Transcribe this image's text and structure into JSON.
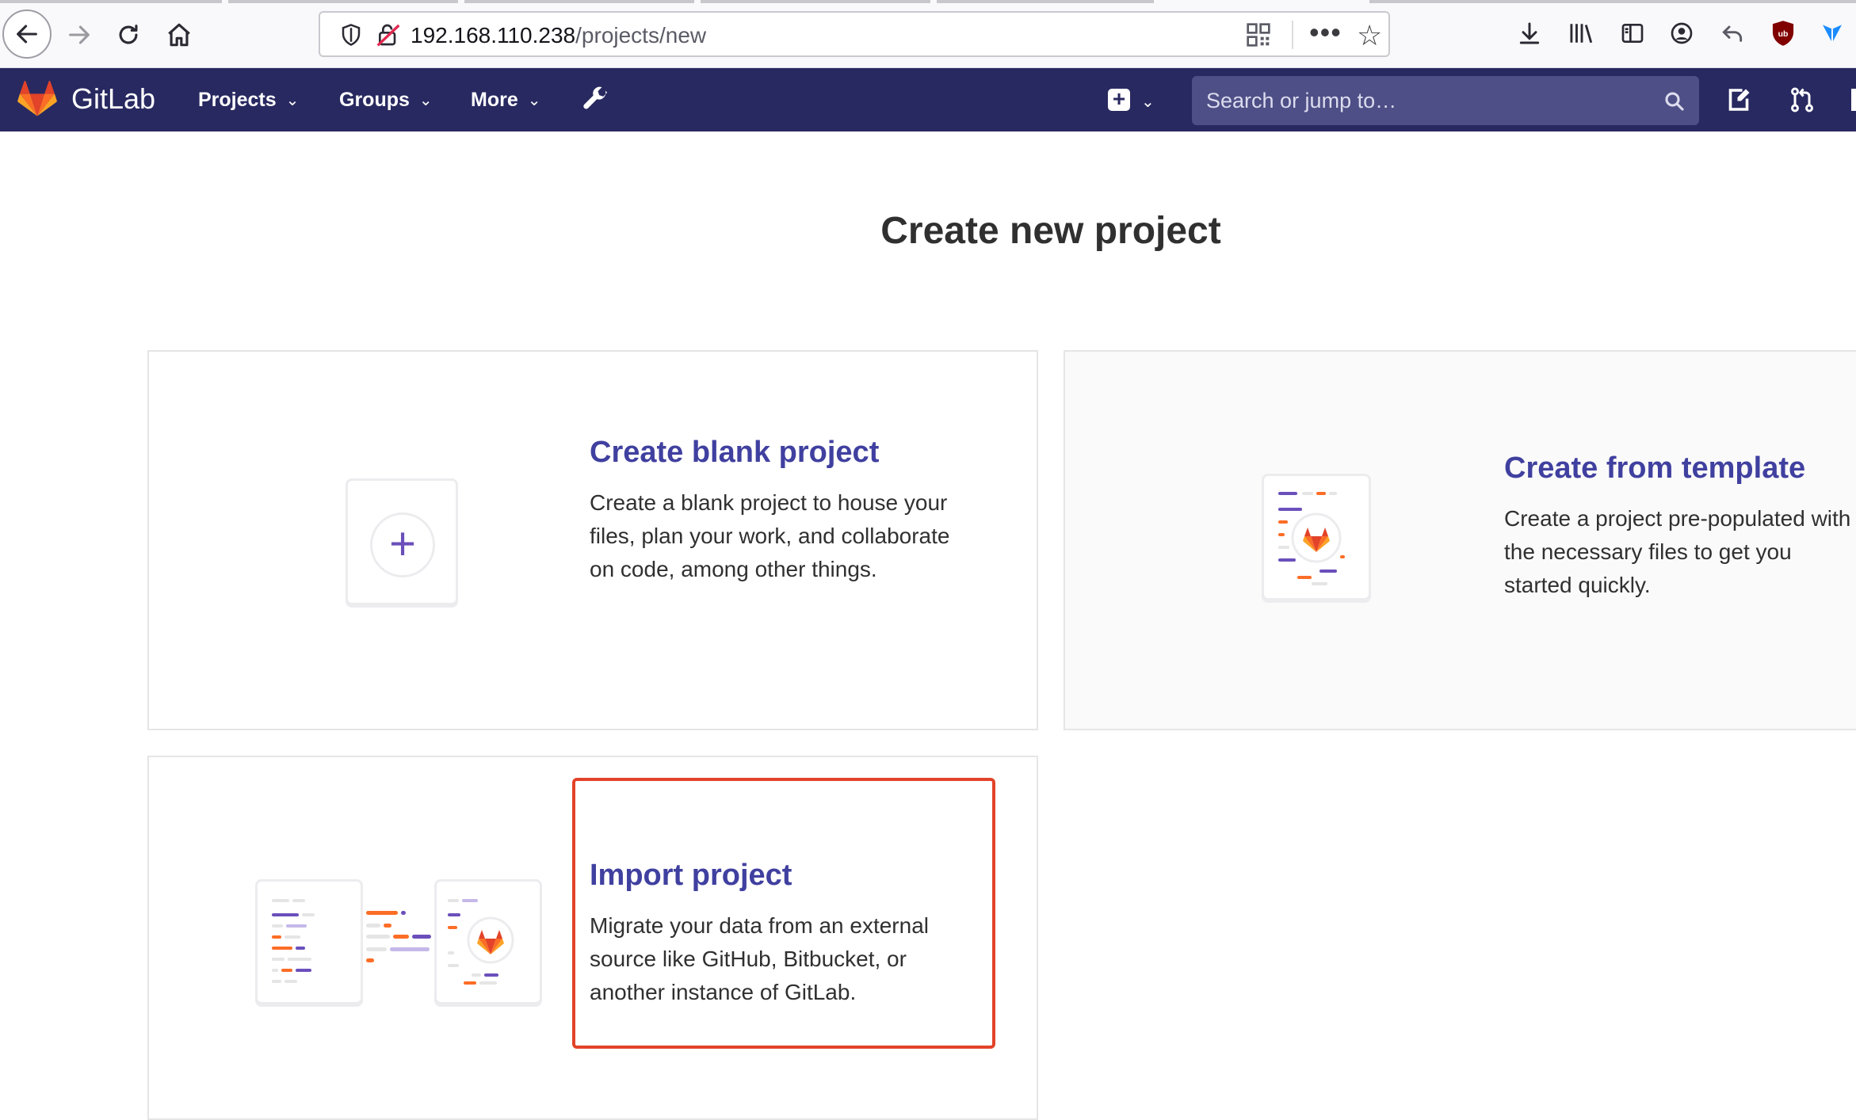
{
  "browser": {
    "url_host": "192.168.110.238",
    "url_path": "/projects/new"
  },
  "navbar": {
    "brand": "GitLab",
    "menu": [
      {
        "label": "Projects"
      },
      {
        "label": "Groups"
      },
      {
        "label": "More"
      }
    ],
    "search_placeholder": "Search or jump to…"
  },
  "page": {
    "title": "Create new project"
  },
  "cards": {
    "blank": {
      "title": "Create blank project",
      "description": "Create a blank project to house your files, plan your work, and collaborate on code, among other things."
    },
    "template": {
      "title": "Create from template",
      "description": "Create a project pre-populated with the necessary files to get you started quickly."
    },
    "import": {
      "title": "Import project",
      "description": "Migrate your data from an external source like GitHub, Bitbucket, or another instance of GitLab."
    }
  },
  "colors": {
    "navbar": "#292961",
    "link": "#4040a0",
    "accent_orange": "#e24329",
    "accent_purple": "#6b4fbb"
  }
}
